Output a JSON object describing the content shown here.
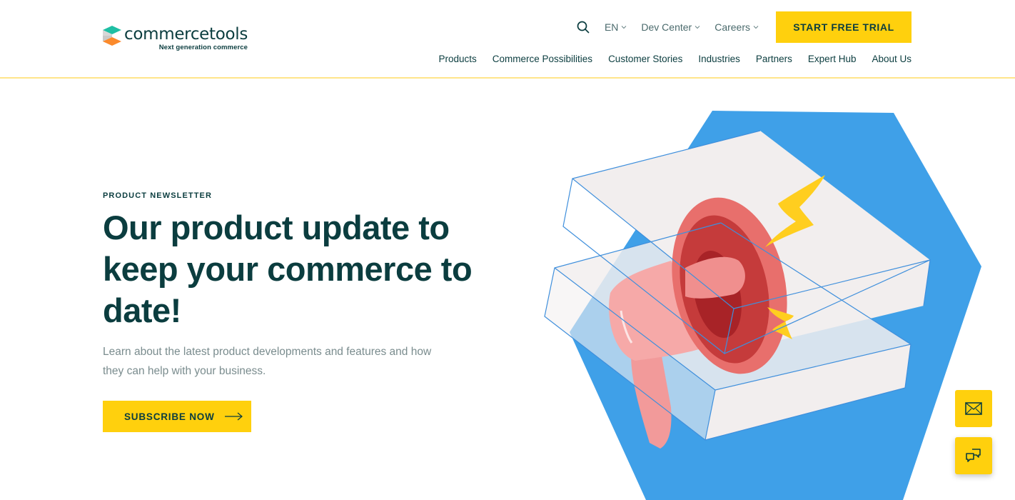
{
  "header": {
    "logo": {
      "name": "commercetools",
      "tagline": "Next generation commerce",
      "icon": "commercetools-cube-logo"
    },
    "utility_nav": {
      "search_icon": "search-icon",
      "items": [
        {
          "label": "EN",
          "icon": "chevron-down-icon"
        },
        {
          "label": "Dev Center",
          "icon": "chevron-down-icon"
        },
        {
          "label": "Careers",
          "icon": "chevron-down-icon"
        }
      ],
      "cta_label": "START FREE TRIAL"
    },
    "main_nav": [
      {
        "label": "Products"
      },
      {
        "label": "Commerce Possibilities"
      },
      {
        "label": "Customer Stories"
      },
      {
        "label": "Industries"
      },
      {
        "label": "Partners"
      },
      {
        "label": "Expert Hub"
      },
      {
        "label": "About Us"
      }
    ]
  },
  "hero": {
    "eyebrow": "PRODUCT NEWSLETTER",
    "headline": "Our product update to keep your commerce to date!",
    "description": "Learn about the latest product developments and features and how they can help with your business.",
    "cta_label": "SUBSCRIBE NOW",
    "cta_icon": "arrow-right-icon",
    "illustration": "megaphone-on-boxes-illustration"
  },
  "floating_actions": [
    {
      "name": "newsletter",
      "icon": "mail-icon"
    },
    {
      "name": "chat",
      "icon": "chat-bubbles-icon"
    }
  ],
  "colors": {
    "brand_dark": "#0b3d3f",
    "accent_yellow": "#ffd00d",
    "header_border": "#ffe58a",
    "illustration_blue": "#3fa0e8",
    "body_gray": "#7a8c8e",
    "logo_teal": "#1fbfa4",
    "logo_orange": "#fb8a2c"
  }
}
